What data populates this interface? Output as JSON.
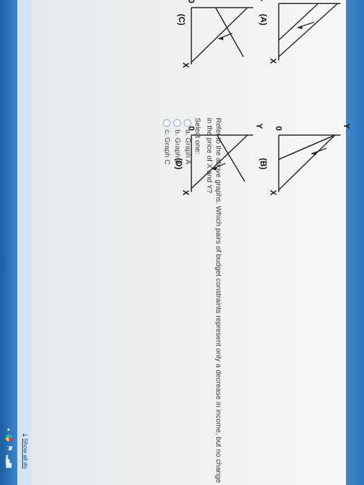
{
  "graphs": [
    {
      "id": "A",
      "label": "(A)",
      "x_label": "X",
      "y_label": "Y",
      "origin": "0"
    },
    {
      "id": "B",
      "label": "(B)",
      "x_label": "X",
      "y_label": "Y",
      "origin": "0"
    },
    {
      "id": "C",
      "label": "(C)",
      "x_label": "X",
      "y_label": "Y",
      "origin": "0"
    },
    {
      "id": "D",
      "label": "(D)",
      "x_label": "X",
      "y_label": "Y",
      "origin": "0"
    }
  ],
  "question": {
    "text": "Refer to the above graphs. Which pairs of budget constraints represent only a decrease in income, but no change in the price of X and Y?",
    "select_label": "Select one:",
    "options": [
      "a. Graph A",
      "b. Graph B",
      "c. Graph C"
    ]
  },
  "download_bar": {
    "show_all_label": "Show all do"
  },
  "tray": {
    "icons": [
      "arrow-icon",
      "color-wheel-icon",
      "flag-icon",
      "signal-icon"
    ]
  },
  "colors": {
    "page_background": "#f1f2f1",
    "taskbar": "#2b6fb7",
    "text": "#333333"
  }
}
